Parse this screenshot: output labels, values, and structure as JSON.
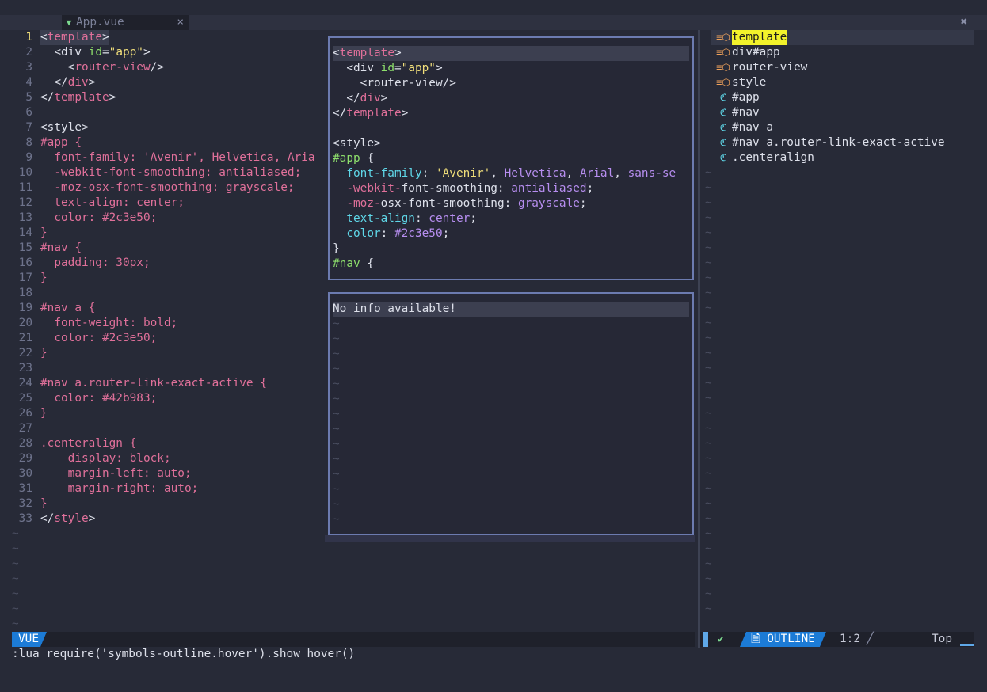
{
  "tabline": {
    "tab_icon": "vue-icon",
    "tab_label": "App.vue",
    "tab_close": "×",
    "close_all": "✖"
  },
  "editor": {
    "lines": [
      {
        "n": "1",
        "tokens": [
          [
            "t-white",
            "<"
          ],
          [
            "t-pink",
            "template"
          ],
          [
            "t-white",
            ">"
          ]
        ]
      },
      {
        "n": "2",
        "tokens": [
          [
            "t-white",
            "  <"
          ],
          [
            "t-white",
            "div "
          ],
          [
            "t-green",
            "id"
          ],
          [
            "t-white",
            "="
          ],
          [
            "t-yellow",
            "\"app\""
          ],
          [
            "t-white",
            ">"
          ]
        ]
      },
      {
        "n": "3",
        "tokens": [
          [
            "t-white",
            "    <"
          ],
          [
            "t-pink",
            "router-view"
          ],
          [
            "t-white",
            "/>"
          ]
        ]
      },
      {
        "n": "4",
        "tokens": [
          [
            "t-white",
            "  </"
          ],
          [
            "t-pink",
            "div"
          ],
          [
            "t-white",
            ">"
          ]
        ]
      },
      {
        "n": "5",
        "tokens": [
          [
            "t-white",
            "</"
          ],
          [
            "t-pink",
            "template"
          ],
          [
            "t-white",
            ">"
          ]
        ]
      },
      {
        "n": "6",
        "tokens": []
      },
      {
        "n": "7",
        "tokens": [
          [
            "t-white",
            "<style>"
          ]
        ]
      },
      {
        "n": "8",
        "tokens": [
          [
            "t-pink",
            "#app {"
          ]
        ]
      },
      {
        "n": "9",
        "tokens": [
          [
            "t-pink",
            "  font-family: 'Avenir', Helvetica, Aria"
          ]
        ]
      },
      {
        "n": "10",
        "tokens": [
          [
            "t-pink",
            "  -webkit-font-smoothing: antialiased;"
          ]
        ]
      },
      {
        "n": "11",
        "tokens": [
          [
            "t-pink",
            "  -moz-osx-font-smoothing: grayscale;"
          ]
        ]
      },
      {
        "n": "12",
        "tokens": [
          [
            "t-pink",
            "  text-align: center;"
          ]
        ]
      },
      {
        "n": "13",
        "tokens": [
          [
            "t-pink",
            "  color: #2c3e50;"
          ]
        ]
      },
      {
        "n": "14",
        "tokens": [
          [
            "t-pink",
            "}"
          ]
        ]
      },
      {
        "n": "15",
        "tokens": [
          [
            "t-pink",
            "#nav {"
          ]
        ]
      },
      {
        "n": "16",
        "tokens": [
          [
            "t-pink",
            "  padding: 30px;"
          ]
        ]
      },
      {
        "n": "17",
        "tokens": [
          [
            "t-pink",
            "}"
          ]
        ]
      },
      {
        "n": "18",
        "tokens": []
      },
      {
        "n": "19",
        "tokens": [
          [
            "t-pink",
            "#nav a {"
          ]
        ]
      },
      {
        "n": "20",
        "tokens": [
          [
            "t-pink",
            "  font-weight: bold;"
          ]
        ]
      },
      {
        "n": "21",
        "tokens": [
          [
            "t-pink",
            "  color: #2c3e50;"
          ]
        ]
      },
      {
        "n": "22",
        "tokens": [
          [
            "t-pink",
            "}"
          ]
        ]
      },
      {
        "n": "23",
        "tokens": []
      },
      {
        "n": "24",
        "tokens": [
          [
            "t-pink",
            "#nav a.router-link-exact-active {"
          ]
        ]
      },
      {
        "n": "25",
        "tokens": [
          [
            "t-pink",
            "  color: #42b983;"
          ]
        ]
      },
      {
        "n": "26",
        "tokens": [
          [
            "t-pink",
            "}"
          ]
        ]
      },
      {
        "n": "27",
        "tokens": []
      },
      {
        "n": "28",
        "tokens": [
          [
            "t-pink",
            ".centeralign {"
          ]
        ]
      },
      {
        "n": "29",
        "tokens": [
          [
            "t-pink",
            "    display: block;"
          ]
        ]
      },
      {
        "n": "30",
        "tokens": [
          [
            "t-pink",
            "    margin-left: auto;"
          ]
        ]
      },
      {
        "n": "31",
        "tokens": [
          [
            "t-pink",
            "    margin-right: auto;"
          ]
        ]
      },
      {
        "n": "32",
        "tokens": [
          [
            "t-pink",
            "}"
          ]
        ]
      },
      {
        "n": "33",
        "tokens": [
          [
            "t-white",
            "</"
          ],
          [
            "t-pink",
            "style"
          ],
          [
            "t-white",
            ">"
          ]
        ]
      }
    ],
    "tilde": "~",
    "tilde_rows": 7
  },
  "hover_preview": {
    "lines": [
      [
        [
          "t-white",
          "<"
        ],
        [
          "t-pink",
          "template"
        ],
        [
          "t-white",
          ">"
        ]
      ],
      [
        [
          "t-white",
          "  <div "
        ],
        [
          "t-green",
          "id"
        ],
        [
          "t-white",
          "="
        ],
        [
          "t-yellow",
          "\"app\""
        ],
        [
          "t-white",
          ">"
        ]
      ],
      [
        [
          "t-white",
          "    <router-view/>"
        ]
      ],
      [
        [
          "t-white",
          "  </"
        ],
        [
          "t-pink",
          "div"
        ],
        [
          "t-white",
          ">"
        ]
      ],
      [
        [
          "t-white",
          "</"
        ],
        [
          "t-pink",
          "template"
        ],
        [
          "t-white",
          ">"
        ]
      ],
      [],
      [
        [
          "t-white",
          "<style>"
        ]
      ],
      [
        [
          "t-green",
          "#app"
        ],
        [
          "t-white",
          " {"
        ]
      ],
      [
        [
          "t-white",
          "  "
        ],
        [
          "t-cyan",
          "font-family"
        ],
        [
          "t-white",
          ": "
        ],
        [
          "t-yellow",
          "'Avenir'"
        ],
        [
          "t-white",
          ", "
        ],
        [
          "t-purple",
          "Helvetica"
        ],
        [
          "t-white",
          ", "
        ],
        [
          "t-purple",
          "Arial"
        ],
        [
          "t-white",
          ", "
        ],
        [
          "t-purple",
          "sans-se"
        ]
      ],
      [
        [
          "t-white",
          "  "
        ],
        [
          "t-pink",
          "-webkit-"
        ],
        [
          "t-white",
          "font-smoothing: "
        ],
        [
          "t-purple",
          "antialiased"
        ],
        [
          "t-white",
          ";"
        ]
      ],
      [
        [
          "t-white",
          "  "
        ],
        [
          "t-pink",
          "-moz-"
        ],
        [
          "t-white",
          "osx-font-smoothing: "
        ],
        [
          "t-purple",
          "grayscale"
        ],
        [
          "t-white",
          ";"
        ]
      ],
      [
        [
          "t-white",
          "  "
        ],
        [
          "t-cyan",
          "text-align"
        ],
        [
          "t-white",
          ": "
        ],
        [
          "t-purple",
          "center"
        ],
        [
          "t-white",
          ";"
        ]
      ],
      [
        [
          "t-white",
          "  "
        ],
        [
          "t-cyan",
          "color"
        ],
        [
          "t-white",
          ": "
        ],
        [
          "t-purple",
          "#2c3e50"
        ],
        [
          "t-white",
          ";"
        ]
      ],
      [
        [
          "t-white",
          "}"
        ]
      ],
      [
        [
          "t-green",
          "#nav"
        ],
        [
          "t-white",
          " {"
        ]
      ]
    ]
  },
  "hover_info": {
    "message": "No info available!",
    "tilde_rows": 14
  },
  "outline": {
    "items": [
      {
        "icon": "≡⬡",
        "icon_name": "tag-icon",
        "icon_color": "#f0a35c",
        "label": "template",
        "selected": true
      },
      {
        "icon": "≡⬡",
        "icon_name": "tag-icon",
        "icon_color": "#f0a35c",
        "label": "div#app",
        "selected": false
      },
      {
        "icon": "≡⬡",
        "icon_name": "tag-icon",
        "icon_color": "#f0a35c",
        "label": "router-view",
        "selected": false
      },
      {
        "icon": "≡⬡",
        "icon_name": "tag-icon",
        "icon_color": "#f0a35c",
        "label": "style",
        "selected": false
      },
      {
        "icon": "ℭ",
        "icon_name": "selector-icon",
        "icon_color": "#5fd7e8",
        "label": "#app",
        "selected": false
      },
      {
        "icon": "ℭ",
        "icon_name": "selector-icon",
        "icon_color": "#5fd7e8",
        "label": "#nav",
        "selected": false
      },
      {
        "icon": "ℭ",
        "icon_name": "selector-icon",
        "icon_color": "#5fd7e8",
        "label": "#nav a",
        "selected": false
      },
      {
        "icon": "ℭ",
        "icon_name": "selector-icon",
        "icon_color": "#5fd7e8",
        "label": "#nav a.router-link-exact-active",
        "selected": false
      },
      {
        "icon": "ℭ",
        "icon_name": "selector-icon",
        "icon_color": "#5fd7e8",
        "label": ".centeralign",
        "selected": false
      }
    ],
    "tilde_rows": 30
  },
  "status_left": {
    "mode": "VUE"
  },
  "status_right": {
    "check_icon": "✔",
    "name_icon": "🗎",
    "name": "OUTLINE",
    "position": "1:2",
    "separator": "╱",
    "scroll": "Top"
  },
  "cmdline": ":lua require('symbols-outline.hover').show_hover()"
}
